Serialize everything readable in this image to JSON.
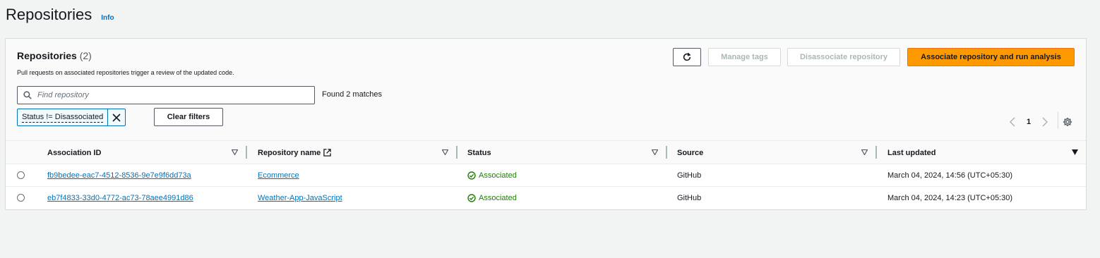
{
  "page": {
    "title": "Repositories",
    "info": "Info"
  },
  "panel": {
    "title": "Repositories",
    "count": "(2)",
    "description": "Pull requests on associated repositories trigger a review of the updated code.",
    "buttons": {
      "refresh": "refresh-icon",
      "manage_tags": "Manage tags",
      "disassociate": "Disassociate repository",
      "associate": "Associate repository and run analysis"
    },
    "search": {
      "placeholder": "Find repository",
      "value": "",
      "matches": "Found 2 matches"
    },
    "filter_token": "Status != Disassociated",
    "clear_filters": "Clear filters",
    "pagination": {
      "current_page": "1"
    }
  },
  "table": {
    "columns": [
      "Association ID",
      "Repository name",
      "Status",
      "Source",
      "Last updated"
    ],
    "rows": [
      {
        "association_id": "fb9bedee-eac7-4512-8536-9e7e9f6dd73a",
        "repository_name": "Ecommerce",
        "status": "Associated",
        "source": "GitHub",
        "last_updated": "March 04, 2024, 14:56 (UTC+05:30)"
      },
      {
        "association_id": "eb7f4833-33d0-4772-ac73-78aee4991d86",
        "repository_name": "Weather-App-JavaScript",
        "status": "Associated",
        "source": "GitHub",
        "last_updated": "March 04, 2024, 14:23 (UTC+05:30)"
      }
    ]
  },
  "colors": {
    "primary_button": "#ff9900",
    "link": "#0073bb",
    "success": "#1d8102"
  }
}
